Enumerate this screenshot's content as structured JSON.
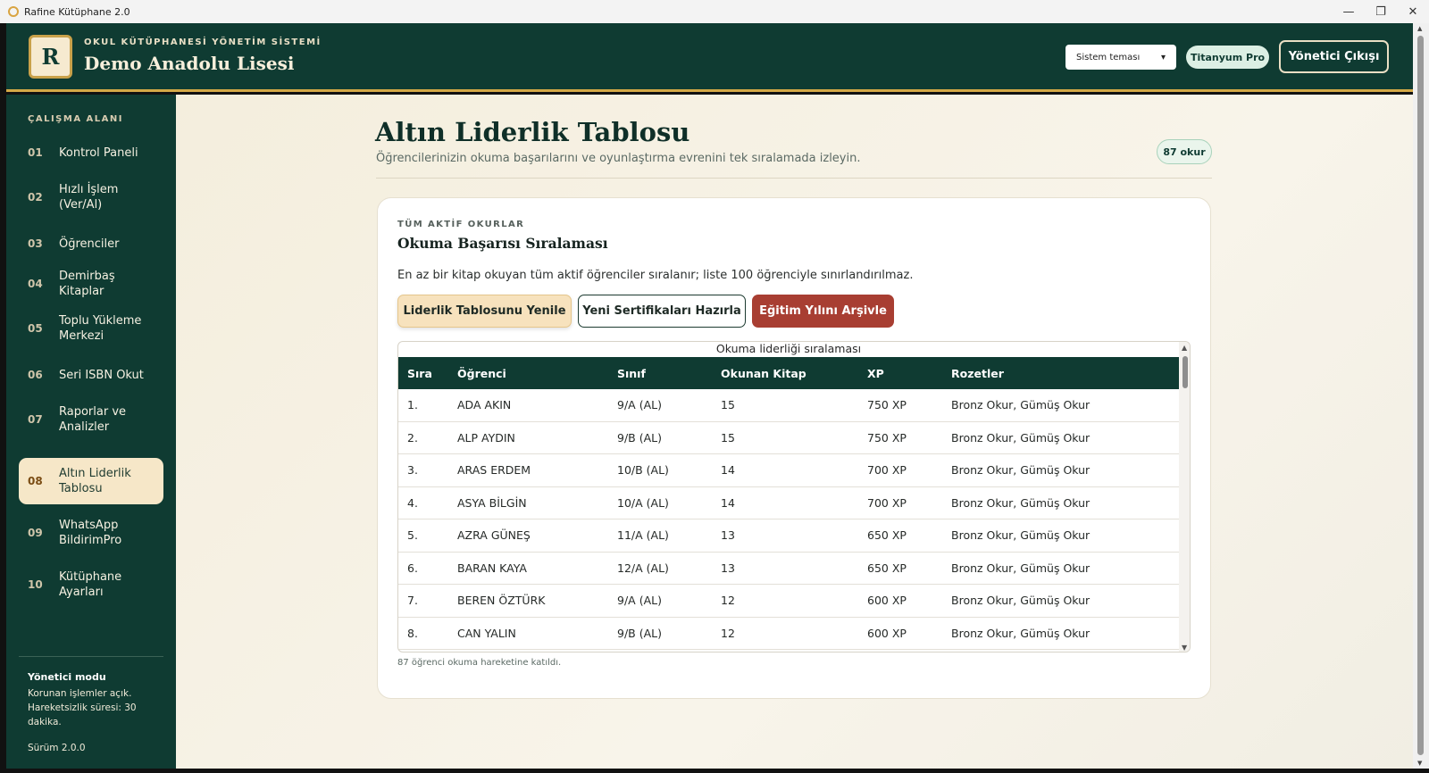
{
  "window": {
    "title": "Rafine Kütüphane 2.0",
    "controls": [
      "—",
      "❐",
      "✕"
    ]
  },
  "header": {
    "logo_letter": "R",
    "system_label": "OKUL KÜTÜPHANESİ YÖNETİM SİSTEMİ",
    "school_name": "Demo Anadolu Lisesi",
    "theme_select": "Sistem teması",
    "pro_badge": "Titanyum Pro",
    "logout": "Yönetici Çıkışı"
  },
  "sidebar": {
    "section_label": "ÇALIŞMA ALANI",
    "items": [
      {
        "num": "01",
        "label": "Kontrol Paneli"
      },
      {
        "num": "02",
        "label": "Hızlı İşlem (Ver/Al)"
      },
      {
        "num": "03",
        "label": "Öğrenciler"
      },
      {
        "num": "04",
        "label": "Demirbaş Kitaplar"
      },
      {
        "num": "05",
        "label": "Toplu Yükleme Merkezi"
      },
      {
        "num": "06",
        "label": "Seri ISBN Okut"
      },
      {
        "num": "07",
        "label": "Raporlar ve Analizler"
      },
      {
        "num": "08",
        "label": "Altın Liderlik Tablosu"
      },
      {
        "num": "09",
        "label": "WhatsApp BildirimPro"
      },
      {
        "num": "10",
        "label": "Kütüphane Ayarları"
      }
    ],
    "active_index": 7,
    "mode_title": "Yönetici modu",
    "mode_text": "Korunan işlemler açık. Hareketsizlik süresi: 30 dakika.",
    "version": "Sürüm 2.0.0"
  },
  "main": {
    "title": "Altın Liderlik Tablosu",
    "subtitle": "Öğrencilerinizin okuma başarılarını ve oyunlaştırma evrenini tek sıralamada izleyin.",
    "count_pill": "87 okur",
    "card": {
      "kicker": "TÜM AKTİF OKURLAR",
      "title": "Okuma Başarısı Sıralaması",
      "description": "En az bir kitap okuyan tüm aktif öğrenciler sıralanır; liste 100 öğrenciyle sınırlandırılmaz.",
      "buttons": {
        "refresh": "Liderlik Tablosunu Yenile",
        "certificates": "Yeni Sertifikaları Hazırla",
        "archive": "Eğitim Yılını Arşivle"
      },
      "table": {
        "caption": "Okuma liderliği sıralaması",
        "columns": [
          "Sıra",
          "Öğrenci",
          "Sınıf",
          "Okunan Kitap",
          "XP",
          "Rozetler"
        ],
        "rows": [
          [
            "1.",
            "ADA AKIN",
            "9/A (AL)",
            "15",
            "750 XP",
            "Bronz Okur, Gümüş Okur"
          ],
          [
            "2.",
            "ALP AYDIN",
            "9/B (AL)",
            "15",
            "750 XP",
            "Bronz Okur, Gümüş Okur"
          ],
          [
            "3.",
            "ARAS ERDEM",
            "10/B (AL)",
            "14",
            "700 XP",
            "Bronz Okur, Gümüş Okur"
          ],
          [
            "4.",
            "ASYA BİLGİN",
            "10/A (AL)",
            "14",
            "700 XP",
            "Bronz Okur, Gümüş Okur"
          ],
          [
            "5.",
            "AZRA GÜNEŞ",
            "11/A (AL)",
            "13",
            "650 XP",
            "Bronz Okur, Gümüş Okur"
          ],
          [
            "6.",
            "BARAN KAYA",
            "12/A (AL)",
            "13",
            "650 XP",
            "Bronz Okur, Gümüş Okur"
          ],
          [
            "7.",
            "BEREN ÖZTÜRK",
            "9/A (AL)",
            "12",
            "600 XP",
            "Bronz Okur, Gümüş Okur"
          ],
          [
            "8.",
            "CAN YALIN",
            "9/B (AL)",
            "12",
            "600 XP",
            "Bronz Okur, Gümüş Okur"
          ]
        ]
      },
      "footer": "87 öğrenci okuma hareketine katıldı."
    }
  },
  "colors": {
    "primary": "#0f3b32",
    "accent_gold": "#d4a947",
    "active_item": "#f6e7c8",
    "archive_red": "#a83e32"
  }
}
